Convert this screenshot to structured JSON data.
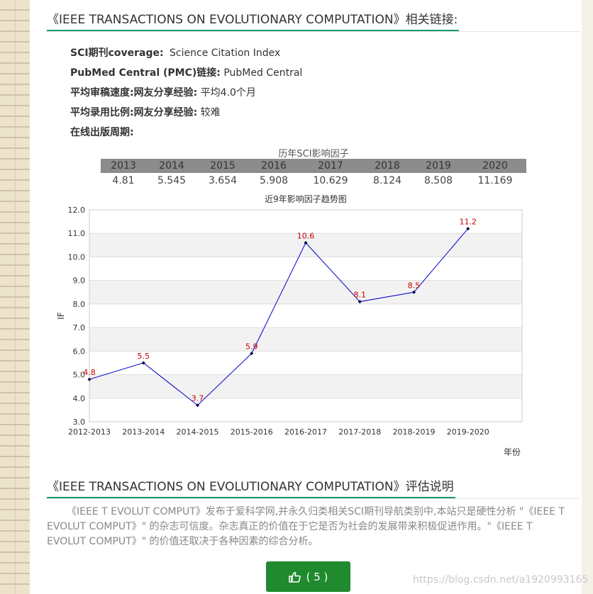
{
  "links_heading": "《IEEE TRANSACTIONS ON EVOLUTIONARY COMPUTATION》相关链接:",
  "info": [
    {
      "key": "SCI期刊coverage:",
      "value": "Science Citation Index"
    },
    {
      "key": "PubMed Central (PMC)链接:",
      "value": "PubMed Central"
    },
    {
      "key": "平均审稿速度:网友分享经验:",
      "value": "平均4.0个月"
    },
    {
      "key": "平均录用比例:网友分享经验:",
      "value": "较难"
    },
    {
      "key": "在线出版周期:",
      "value": ""
    }
  ],
  "if_table": {
    "caption": "历年SCI影响因子",
    "years": [
      "2013",
      "2014",
      "2015",
      "2016",
      "2017",
      "2018",
      "2019",
      "2020"
    ],
    "values": [
      "4.81",
      "5.545",
      "3.654",
      "5.908",
      "10.629",
      "8.124",
      "8.508",
      "11.169"
    ]
  },
  "chart_data": {
    "type": "line",
    "title": "近9年影响因子趋势图",
    "xlabel": "年份",
    "ylabel": "IF",
    "categories": [
      "2012-2013",
      "2013-2014",
      "2014-2015",
      "2015-2016",
      "2016-2017",
      "2017-2018",
      "2018-2019",
      "2019-2020"
    ],
    "series": [
      {
        "values": [
          4.8,
          5.5,
          3.7,
          5.9,
          10.6,
          8.1,
          8.5,
          11.2
        ]
      }
    ],
    "ylim": [
      3.0,
      12.0
    ],
    "yticks": [
      "3.0",
      "4.0",
      "5.0",
      "6.0",
      "7.0",
      "8.0",
      "9.0",
      "10.0",
      "11.0",
      "12.0"
    ],
    "point_labels": [
      "4.8",
      "5.5",
      "3.7",
      "5.9",
      "10.6",
      "8.1",
      "8.5",
      "11.2"
    ],
    "grid": true,
    "line_color": "#0000cc",
    "label_color": "#cc0000"
  },
  "eval_heading": "《IEEE TRANSACTIONS ON EVOLUTIONARY COMPUTATION》评估说明",
  "eval_text": "《IEEE T EVOLUT COMPUT》发布于爱科学网,并永久归类相关SCI期刊导航类别中,本站只是硬性分析 \"《IEEE T EVOLUT COMPUT》\" 的杂志可信度。杂志真正的价值在于它是否为社会的发展带来积极促进作用。\"《IEEE T EVOLUT COMPUT》\" 的价值还取决于各种因素的综合分析。",
  "like": {
    "icon": "thumbs-up-icon",
    "label": "( 5 )",
    "color": "#1f8a2e"
  },
  "watermark": "https://blog.csdn.net/a1920993165"
}
